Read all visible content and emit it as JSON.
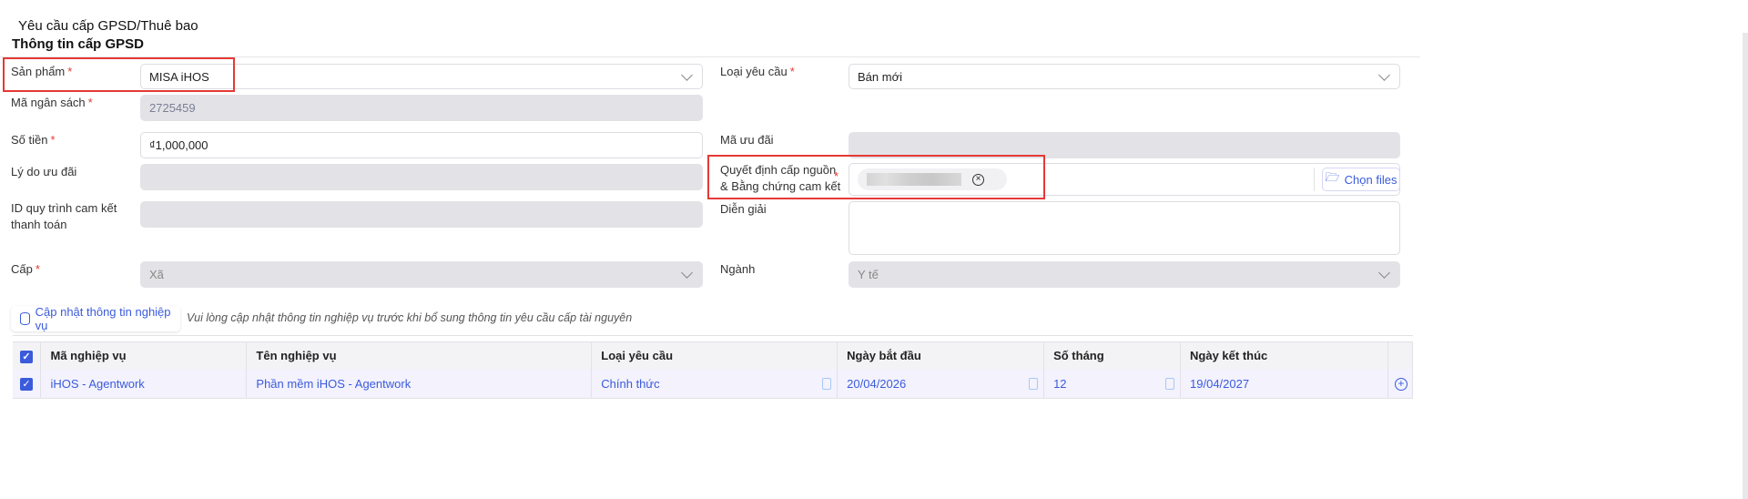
{
  "page": {
    "title": "Yêu cầu cấp GPSD/Thuê bao",
    "section": "Thông tin cấp GPSD"
  },
  "form": {
    "san_pham": {
      "label": "Sản phẩm",
      "value": "MISA iHOS"
    },
    "loai_yeu_cau": {
      "label": "Loại yêu cầu",
      "value": "Bán mới"
    },
    "ma_ngan_sach": {
      "label": "Mã ngân sách",
      "value": "2725459"
    },
    "so_tien": {
      "label": "Số tiền",
      "value": "₫1,000,000"
    },
    "ma_uu_dai": {
      "label": "Mã ưu đãi",
      "value": ""
    },
    "ly_do_uu_dai": {
      "label": "Lý do ưu đãi",
      "value": ""
    },
    "quyet_dinh": {
      "label_line1": "Quyết định cấp nguồn",
      "label_line2": "& Bằng chứng cam kết",
      "button": "Chọn files"
    },
    "id_quy_trinh": {
      "label_line1": "ID quy trình cam kết",
      "label_line2": "thanh toán",
      "value": ""
    },
    "dien_giai": {
      "label": "Diễn giải",
      "value": ""
    },
    "cap": {
      "label": "Cấp",
      "value": "Xã"
    },
    "nganh": {
      "label": "Ngành",
      "value": "Y tế"
    },
    "required_mark": "*"
  },
  "actions": {
    "update_button": "Cập nhật thông tin nghiệp vụ",
    "note": "Vui lòng cập nhật thông tin nghiệp vụ trước khi bổ sung thông tin yêu cầu cấp tài nguyên"
  },
  "table": {
    "headers": [
      "Mã nghiệp vụ",
      "Tên nghiệp vụ",
      "Loại yêu cầu",
      "Ngày bắt đầu",
      "Số tháng",
      "Ngày kết thúc"
    ],
    "rows": [
      {
        "ma": "iHOS - Agentwork",
        "ten": "Phần mềm iHOS - Agentwork",
        "loai": "Chính thức",
        "bat_dau": "20/04/2026",
        "so_thang": "12",
        "ket_thuc": "19/04/2027",
        "checked": true
      }
    ]
  },
  "colors": {
    "accent": "#3b5bdb",
    "highlight": "#e53935"
  }
}
